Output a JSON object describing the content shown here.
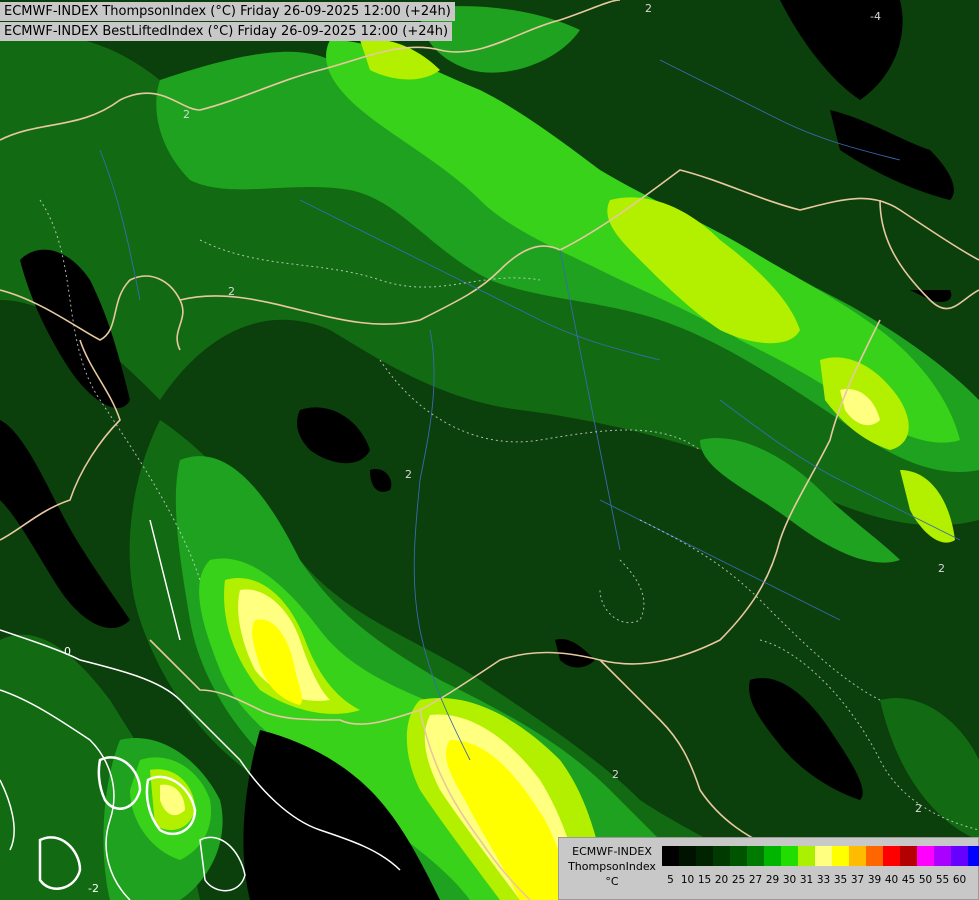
{
  "titles": {
    "line1": "ECMWF-INDEX ThompsonIndex (°C) Friday 26-09-2025 12:00 (+24h)",
    "line2": "ECMWF-INDEX BestLiftedIndex (°C) Friday 26-09-2025 12:00 (+24h)"
  },
  "legend": {
    "model": "ECMWF-INDEX",
    "variable": "ThompsonIndex",
    "unit": "°C",
    "bins": [
      {
        "label": "5",
        "color": "#000000"
      },
      {
        "label": "10",
        "color": "#001200"
      },
      {
        "label": "15",
        "color": "#002400"
      },
      {
        "label": "20",
        "color": "#003a00"
      },
      {
        "label": "25",
        "color": "#005400"
      },
      {
        "label": "27",
        "color": "#007a00"
      },
      {
        "label": "29",
        "color": "#00b400"
      },
      {
        "label": "30",
        "color": "#22dd00"
      },
      {
        "label": "31",
        "color": "#aaf000"
      },
      {
        "label": "33",
        "color": "#ffff80"
      },
      {
        "label": "35",
        "color": "#ffff00"
      },
      {
        "label": "37",
        "color": "#ffbb00"
      },
      {
        "label": "39",
        "color": "#ff6600"
      },
      {
        "label": "40",
        "color": "#ff0000"
      },
      {
        "label": "45",
        "color": "#b40000"
      },
      {
        "label": "50",
        "color": "#ff00ff"
      },
      {
        "label": "55",
        "color": "#aa00ff"
      },
      {
        "label": "60",
        "color": "#6600ff"
      },
      {
        "label": "",
        "color": "#0000ff"
      }
    ]
  },
  "contour_labels": [
    "2",
    "2",
    "2",
    "2",
    "2",
    "2",
    "2",
    "-4",
    "0",
    "-2"
  ]
}
